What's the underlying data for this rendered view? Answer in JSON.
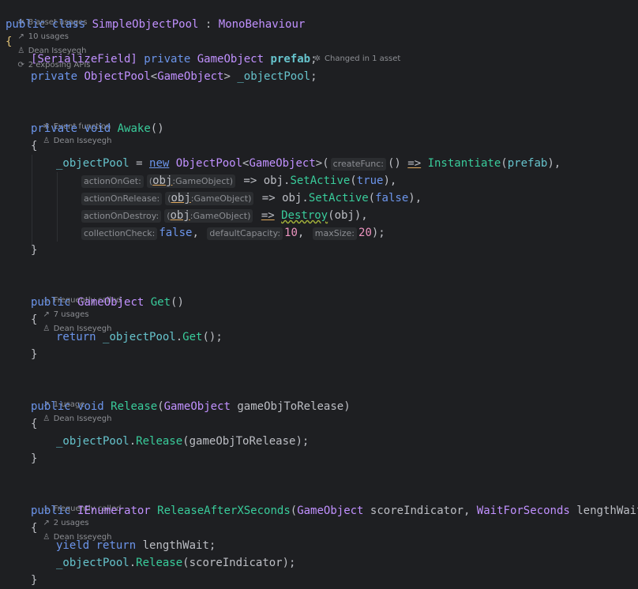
{
  "hints": {
    "class_hint": {
      "assets": "8 asset usages",
      "usages": "10 usages",
      "author": "Dean Isseyegh",
      "apis": "2 exposing APIs"
    },
    "prefab_hint": "Changed in 1 asset",
    "awake_hint": {
      "event": "Event function",
      "author": "Dean Isseyegh"
    },
    "get_hint": {
      "freq": "Frequently called",
      "usages": "7 usages",
      "author": "Dean Isseyegh"
    },
    "release_hint": {
      "usages": "1 usage",
      "author": "Dean Isseyegh"
    },
    "release_after_hint": {
      "freq": "Frequently called",
      "usages": "2 usages",
      "author": "Dean Isseyegh"
    }
  },
  "params": {
    "createFunc": "createFunc:",
    "actionOnGet": "actionOnGet:",
    "actionOnRelease": "actionOnRelease:",
    "actionOnDestroy": "actionOnDestroy:",
    "collectionCheck": "collectionCheck:",
    "defaultCapacity": "defaultCapacity:",
    "maxSize": "maxSize:",
    "objType": ":GameObject"
  },
  "code": {
    "public": "public",
    "class": "class",
    "className": "SimpleObjectPool",
    "colon": " : ",
    "mono": "MonoBehaviour",
    "serializeField": "[SerializeField]",
    "private": "private",
    "GameObject": "GameObject",
    "prefab": "prefab",
    "ObjectPool": "ObjectPool",
    "objectPool": "_objectPool",
    "void": "void",
    "Awake": "Awake",
    "new": "new",
    "Instantiate": "Instantiate",
    "obj": "obj",
    "SetActive": "SetActive",
    "true": "true",
    "false": "false",
    "Destroy": "Destroy",
    "ten": "10",
    "twenty": "20",
    "Get": "Get",
    "return": "return",
    "Release": "Release",
    "gameObjToRelease": "gameObjToRelease",
    "IEnumerator": "IEnumerator",
    "ReleaseAfterXSeconds": "ReleaseAfterXSeconds",
    "scoreIndicator": "scoreIndicator",
    "WaitForSeconds": "WaitForSeconds",
    "lengthWait": "lengthWait",
    "yield": "yield"
  }
}
